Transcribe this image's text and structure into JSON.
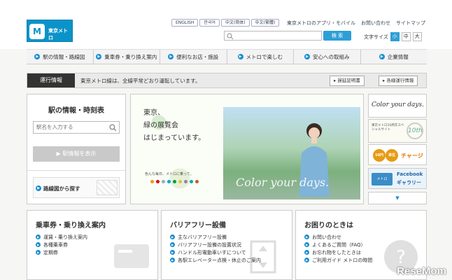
{
  "header": {
    "logo_text": "東京メトロ",
    "languages": [
      "ENGLISH",
      "한국어",
      "中文(简体)",
      "中文(繁體)"
    ],
    "util_links": [
      "東京メトロのアプリ・モバイル",
      "お問い合わせ",
      "サイトマップ"
    ],
    "search_placeholder": "",
    "search_button": "検 索",
    "text_size_label": "文字サイズ",
    "text_sizes": [
      "小",
      "中",
      "大"
    ]
  },
  "gnav": [
    "駅の情報・路線図",
    "乗車券・乗り換え案内",
    "便利なお店・施設",
    "メトロで楽しむ",
    "安心への取組み",
    "企業情報"
  ],
  "train_info": {
    "label": "運行情報",
    "text": "東京メトロ線は、全線平常どおり運転しています。",
    "delay_button": "遅延証明書",
    "lines_button": "各線運行情報"
  },
  "station": {
    "title": "駅の情報・時刻表",
    "input_placeholder": "駅名を入力する",
    "button": "駅情報を表示",
    "route_link": "路線図から探す"
  },
  "hero": {
    "copy_line1": "東京、",
    "copy_line2": "緑の展覧会",
    "copy_line3": "はじまっています。",
    "sub": "色んな毎日、メトロに乗って。",
    "overlay": "Color your days."
  },
  "banners": {
    "b1": "Color your days.",
    "b2": "東京メトロ10周年スペシャルサイト",
    "b2_badge": "10th",
    "b3_badge1": "10円",
    "b3_badge2": "単位",
    "b3_text": "チャージ",
    "b4_fb": "メトロ",
    "b4_t1": "Facebook",
    "b4_t2": "ギャラリー",
    "more": "▼"
  },
  "panels": [
    {
      "title": "乗車券・乗り換え案内",
      "items": [
        "運賃・乗り換え案内",
        "各種乗車券",
        "定期券"
      ]
    },
    {
      "title": "バリアフリー設備",
      "items": [
        "主なバリアフリー設備",
        "バリアフリー設備の設置状況",
        "ハンドル形電動車いすについて",
        "各駅エレベーター点検・休止のご案内"
      ]
    },
    {
      "title": "お困りのときは",
      "items": [
        "お問い合わせ",
        "よくあるご質問（FAQ）",
        "お忘れ物をしたときは",
        "ご利用ガイド メトロの時間"
      ]
    }
  ],
  "watermark": "ReseMom",
  "colors": {
    "accent": "#1a8fcf",
    "logo": "#0b93c9",
    "train_label": "#333333"
  }
}
